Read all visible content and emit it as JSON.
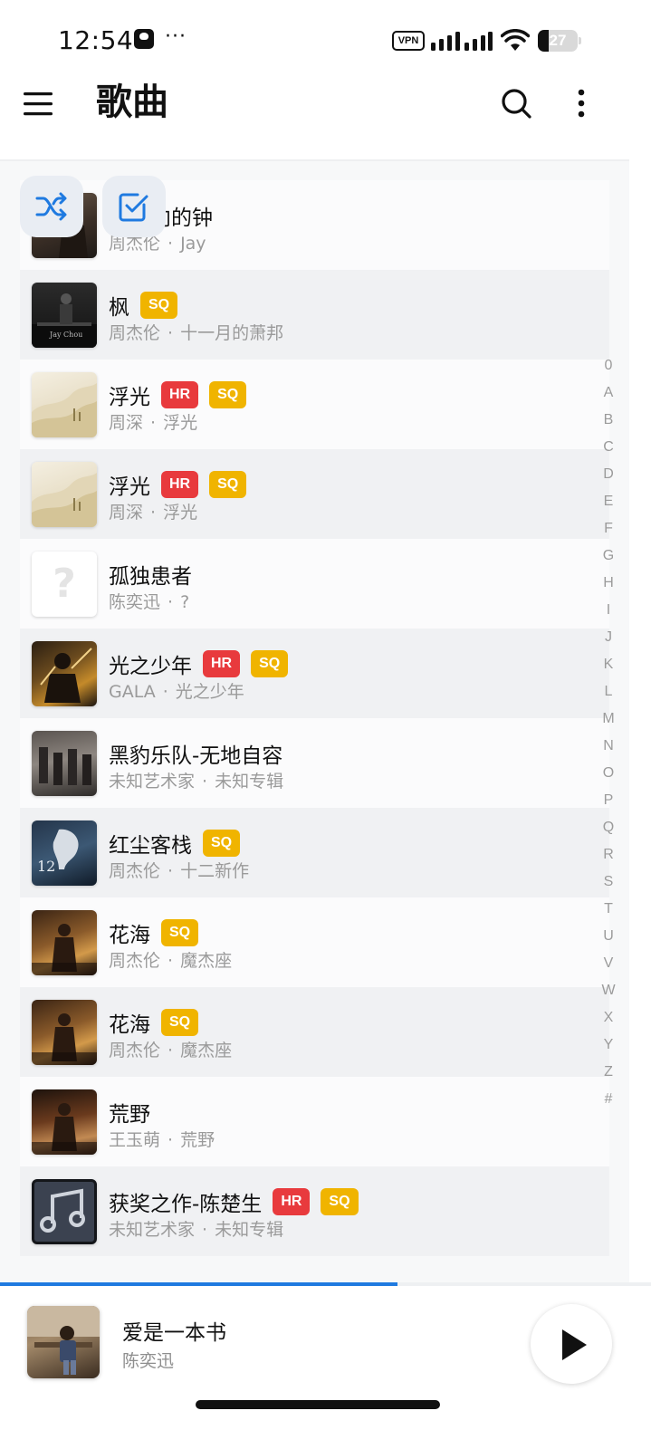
{
  "status_bar": {
    "time": "12:54",
    "dots": "···",
    "vpn_label": "VPN",
    "battery_percent": "27",
    "battery_level": 0.27
  },
  "header": {
    "title": "歌曲"
  },
  "songs": [
    {
      "title": "反方向的钟",
      "artist": "周杰伦",
      "album": "Jay",
      "badges": []
    },
    {
      "title": "枫",
      "artist": "周杰伦",
      "album": "十一月的萧邦",
      "badges": [
        "SQ"
      ]
    },
    {
      "title": "浮光",
      "artist": "周深",
      "album": "浮光",
      "badges": [
        "HR",
        "SQ"
      ]
    },
    {
      "title": "浮光",
      "artist": "周深",
      "album": "浮光",
      "badges": [
        "HR",
        "SQ"
      ]
    },
    {
      "title": "孤独患者",
      "artist": "陈奕迅",
      "album": "?",
      "badges": []
    },
    {
      "title": "光之少年",
      "artist": "GALA",
      "album": "光之少年",
      "badges": [
        "HR",
        "SQ"
      ]
    },
    {
      "title": "黑豹乐队-无地自容",
      "artist": "未知艺术家",
      "album": "未知专辑",
      "badges": []
    },
    {
      "title": "红尘客栈",
      "artist": "周杰伦",
      "album": "十二新作",
      "badges": [
        "SQ"
      ]
    },
    {
      "title": "花海",
      "artist": "周杰伦",
      "album": "魔杰座",
      "badges": [
        "SQ"
      ]
    },
    {
      "title": "花海",
      "artist": "周杰伦",
      "album": "魔杰座",
      "badges": [
        "SQ"
      ]
    },
    {
      "title": "荒野",
      "artist": "王玉萌",
      "album": "荒野",
      "badges": []
    },
    {
      "title": "获奖之作-陈楚生",
      "artist": "未知艺术家",
      "album": "未知专辑",
      "badges": [
        "HR",
        "SQ"
      ]
    }
  ],
  "separator": "·",
  "alphabet_index": [
    "0",
    "A",
    "B",
    "C",
    "D",
    "E",
    "F",
    "G",
    "H",
    "I",
    "J",
    "K",
    "L",
    "M",
    "N",
    "O",
    "P",
    "Q",
    "R",
    "S",
    "T",
    "U",
    "V",
    "W",
    "X",
    "Y",
    "Z",
    "#"
  ],
  "now_playing": {
    "title": "爱是一本书",
    "artist": "陈奕迅",
    "progress": 0.61
  },
  "colors": {
    "accent": "#1f7ae0",
    "badge_hr": "#e83a3d",
    "badge_sq": "#f0b400",
    "action_button_bg": "#e9edf3"
  },
  "icons": {
    "menu": "menu-icon",
    "search": "search-icon",
    "more": "more-vertical-icon",
    "shuffle": "shuffle-icon",
    "multi_select": "checkbox-icon",
    "play": "play-icon"
  }
}
